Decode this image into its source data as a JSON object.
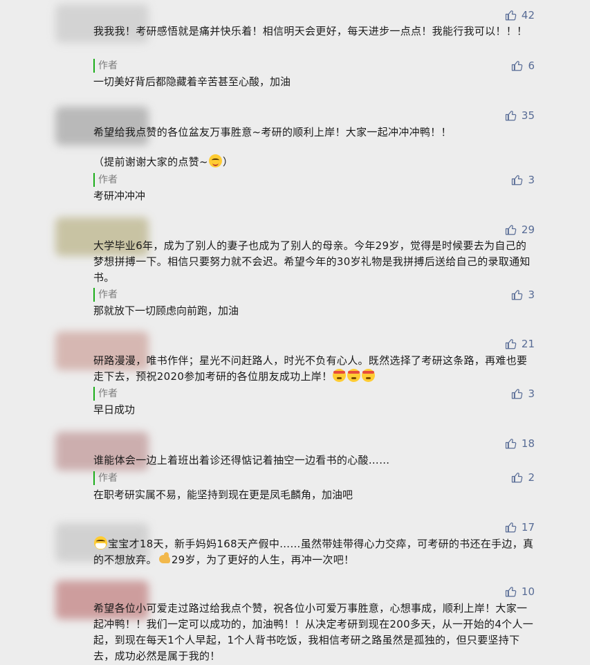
{
  "comments": [
    {
      "likes": "42",
      "text": "我我我！考研感悟就是痛并快乐着！相信明天会更好，每天进步一点点！我能行我可以！！！",
      "author_label": "作者",
      "reply_likes": "6",
      "reply": "一切美好背后都隐藏着辛苦甚至心酸，加油",
      "avatar_color": "#c9c9c9"
    },
    {
      "likes": "35",
      "text": "希望给我点赞的各位盆友万事胜意~考研的顺利上岸！大家一起冲冲冲鸭！！",
      "text_extra": "（提前谢谢大家的点赞~",
      "text_extra_end": "）",
      "author_label": "作者",
      "reply_likes": "3",
      "reply": "考研冲冲冲",
      "avatar_color": "#a8a8a8"
    },
    {
      "likes": "29",
      "text": "大学毕业6年，成为了别人的妻子也成为了别人的母亲。今年29岁，觉得是时候要去为自己的梦想拼搏一下。相信只要努力就不会迟。希望今年的30岁礼物是我拼搏后送给自己的录取通知书。",
      "author_label": "作者",
      "reply_likes": "3",
      "reply": "那就放下一切顾虑向前跑，加油",
      "avatar_color": "#b9b28a"
    },
    {
      "likes": "21",
      "text": "研路漫漫，唯书作伴；星光不问赶路人，时光不负有心人。既然选择了考研这条路，再难也要走下去，预祝2020参加考研的各位朋友成功上岸！",
      "author_label": "作者",
      "reply_likes": "3",
      "reply": "早日成功",
      "avatar_color": "#c9a09a"
    },
    {
      "likes": "18",
      "text": "谁能体会一边上着班出着诊还得惦记着抽空一边看书的心酸……",
      "author_label": "作者",
      "reply_likes": "2",
      "reply": "在职考研实属不易，能坚持到现在更是凤毛麟角，加油吧",
      "avatar_color": "#b89494"
    },
    {
      "likes": "17",
      "text": "宝宝才18天，新手妈妈168天产假中……虽然带娃带得心力交瘁，可考研的书还在手边，真的不想放弃。",
      "text_tail": "29岁，为了更好的人生，再冲一次吧！",
      "avatar_color": "#c4c4c4"
    },
    {
      "likes": "10",
      "text": "希望各位小可爱走过路过给我点个赞，祝各位小可爱万事胜意，心想事成，顺利上岸！大家一起冲鸭！！我们一定可以成功的，加油鸭！！从决定考研到现在200多天，从一开始的4个人一起，到现在每天1个人早起，1个人背书吃饭，我相信考研之路虽然是孤独的，但只要坚持下去，成功必然是属于我的！",
      "avatar_color": "#c08a8a"
    }
  ]
}
